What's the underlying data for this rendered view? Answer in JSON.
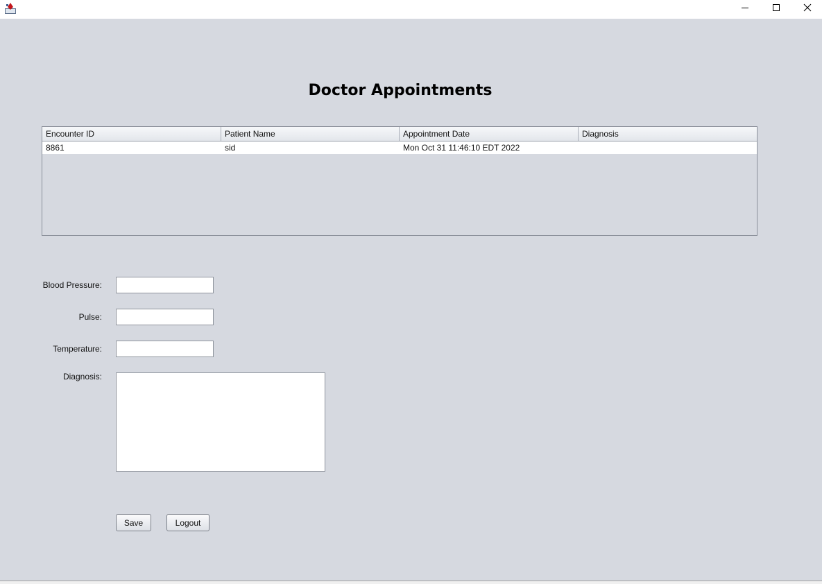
{
  "window": {
    "icon": "java-app-icon",
    "controls": {
      "minimize": "minimize-icon",
      "maximize": "maximize-icon",
      "close": "close-icon"
    }
  },
  "page": {
    "title": "Doctor Appointments"
  },
  "table": {
    "columns": [
      "Encounter ID",
      "Patient Name",
      "Appointment Date",
      "Diagnosis"
    ],
    "rows": [
      [
        "8861",
        "sid",
        "Mon Oct 31 11:46:10 EDT 2022",
        ""
      ]
    ]
  },
  "form": {
    "blood_pressure_label": "Blood Pressure:",
    "blood_pressure_value": "",
    "pulse_label": "Pulse:",
    "pulse_value": "",
    "temperature_label": "Temperature:",
    "temperature_value": "",
    "diagnosis_label": "Diagnosis:",
    "diagnosis_value": ""
  },
  "buttons": {
    "save": "Save",
    "logout": "Logout"
  },
  "colors": {
    "background": "#d6d9e0",
    "titlebar": "#ffffff",
    "field": "#ffffff"
  }
}
